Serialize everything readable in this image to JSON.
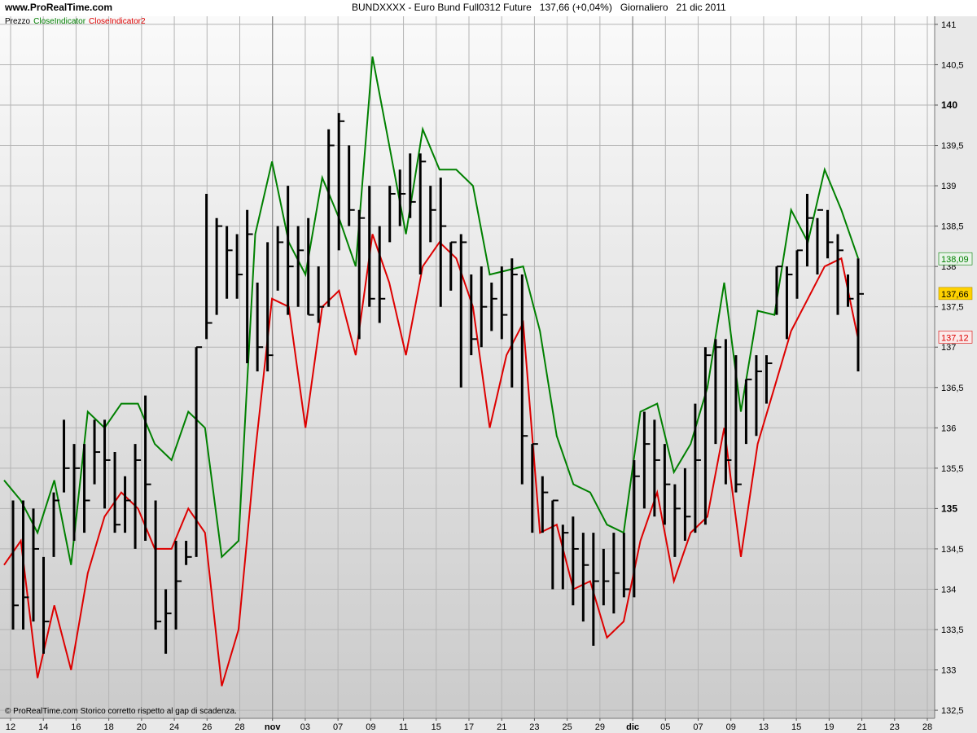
{
  "header": {
    "site": "www.ProRealTime.com",
    "instrument": "BUNDXXXX - Euro Bund Full0312 Future",
    "last_change": "137,66 (+0,04%)",
    "period": "Giornaliero",
    "date": "21 dic 2011"
  },
  "legend": [
    {
      "label": "Prezzo",
      "color": "#000000"
    },
    {
      "label": "CloseIndicator",
      "color": "#008000"
    },
    {
      "label": "CloseIndicator2",
      "color": "#dd0000"
    }
  ],
  "footer": {
    "copyright": "© ProRealTime.com  Storico corretto rispetto al gap di scadenza."
  },
  "chart_data": {
    "type": "line",
    "ylim": [
      132.4,
      141.1
    ],
    "grid": true,
    "y_ticks": [
      "141",
      "140,5",
      "140",
      "139,5",
      "139",
      "138,5",
      "138",
      "137,5",
      "137",
      "136,5",
      "136",
      "135,5",
      "135",
      "134,5",
      "134",
      "133,5",
      "133",
      "132,5"
    ],
    "y_tick_values": [
      141,
      140.5,
      140,
      139.5,
      139,
      138.5,
      138,
      137.5,
      137,
      136.5,
      136,
      135.5,
      135,
      134.5,
      134,
      133.5,
      133,
      132.5
    ],
    "bold_ticks": [
      140,
      135
    ],
    "x_ticks": [
      "12",
      "14",
      "16",
      "18",
      "20",
      "24",
      "26",
      "28",
      "nov",
      "03",
      "07",
      "09",
      "11",
      "15",
      "17",
      "21",
      "23",
      "25",
      "29",
      "dic",
      "05",
      "07",
      "09",
      "13",
      "15",
      "19",
      "21",
      "23",
      "28"
    ],
    "bold_x_ticks": [
      "nov",
      "dic"
    ],
    "price_bars": [
      {
        "high": 135.1,
        "low": 133.5,
        "close": 133.8
      },
      {
        "high": 135.1,
        "low": 133.5,
        "close": 133.9
      },
      {
        "high": 135.0,
        "low": 133.6,
        "close": 134.5
      },
      {
        "high": 134.4,
        "low": 133.2,
        "close": 133.6
      },
      {
        "high": 135.2,
        "low": 134.4,
        "close": 135.1
      },
      {
        "high": 136.1,
        "low": 135.2,
        "close": 135.5
      },
      {
        "high": 135.8,
        "low": 134.6,
        "close": 135.5
      },
      {
        "high": 135.8,
        "low": 134.7,
        "close": 135.1
      },
      {
        "high": 136.1,
        "low": 135.3,
        "close": 135.7
      },
      {
        "high": 136.1,
        "low": 135.0,
        "close": 135.6
      },
      {
        "high": 135.7,
        "low": 134.7,
        "close": 134.8
      },
      {
        "high": 135.4,
        "low": 134.7,
        "close": 135.1
      },
      {
        "high": 135.8,
        "low": 134.5,
        "close": 135.6
      },
      {
        "high": 136.4,
        "low": 134.6,
        "close": 135.3
      },
      {
        "high": 135.1,
        "low": 133.5,
        "close": 133.6
      },
      {
        "high": 134.0,
        "low": 133.2,
        "close": 133.7
      },
      {
        "high": 134.6,
        "low": 133.5,
        "close": 134.1
      },
      {
        "high": 134.6,
        "low": 134.3,
        "close": 134.4
      },
      {
        "high": 137.0,
        "low": 134.4,
        "close": 137.0
      },
      {
        "high": 138.9,
        "low": 137.1,
        "close": 137.3
      },
      {
        "high": 138.6,
        "low": 137.4,
        "close": 138.5
      },
      {
        "high": 138.5,
        "low": 137.6,
        "close": 138.2
      },
      {
        "high": 138.4,
        "low": 137.6,
        "close": 137.9
      },
      {
        "high": 138.7,
        "low": 136.8,
        "close": 138.4
      },
      {
        "high": 137.8,
        "low": 136.7,
        "close": 137.0
      },
      {
        "high": 138.3,
        "low": 136.7,
        "close": 136.9
      },
      {
        "high": 138.5,
        "low": 137.7,
        "close": 138.3
      },
      {
        "high": 139.0,
        "low": 137.4,
        "close": 138.0
      },
      {
        "high": 138.5,
        "low": 137.5,
        "close": 138.2
      },
      {
        "high": 138.6,
        "low": 137.4,
        "close": 137.4
      },
      {
        "high": 138.0,
        "low": 137.3,
        "close": 137.5
      },
      {
        "high": 139.7,
        "low": 137.5,
        "close": 139.5
      },
      {
        "high": 139.9,
        "low": 138.2,
        "close": 139.8
      },
      {
        "high": 139.5,
        "low": 138.5,
        "close": 138.7
      },
      {
        "high": 138.7,
        "low": 137.1,
        "close": 138.6
      },
      {
        "high": 139.0,
        "low": 137.5,
        "close": 137.6
      },
      {
        "high": 138.5,
        "low": 137.3,
        "close": 137.6
      },
      {
        "high": 139.0,
        "low": 138.3,
        "close": 138.9
      },
      {
        "high": 139.2,
        "low": 138.5,
        "close": 138.9
      },
      {
        "high": 139.4,
        "low": 138.6,
        "close": 138.8
      },
      {
        "high": 139.4,
        "low": 137.9,
        "close": 139.3
      },
      {
        "high": 139.0,
        "low": 138.3,
        "close": 138.7
      },
      {
        "high": 139.1,
        "low": 137.5,
        "close": 138.5
      },
      {
        "high": 138.3,
        "low": 137.7,
        "close": 138.3
      },
      {
        "high": 138.4,
        "low": 136.5,
        "close": 138.3
      },
      {
        "high": 137.9,
        "low": 136.9,
        "close": 137.1
      },
      {
        "high": 138.0,
        "low": 137.0,
        "close": 137.5
      },
      {
        "high": 137.8,
        "low": 137.2,
        "close": 137.6
      },
      {
        "high": 138.0,
        "low": 137.1,
        "close": 137.4
      },
      {
        "high": 138.1,
        "low": 136.5,
        "close": 137.9
      },
      {
        "high": 137.9,
        "low": 135.3,
        "close": 135.9
      },
      {
        "high": 135.8,
        "low": 134.7,
        "close": 135.8
      },
      {
        "high": 135.4,
        "low": 134.7,
        "close": 135.2
      },
      {
        "high": 135.1,
        "low": 134.0,
        "close": 135.1
      },
      {
        "high": 134.8,
        "low": 134.0,
        "close": 134.7
      },
      {
        "high": 134.9,
        "low": 133.8,
        "close": 134.5
      },
      {
        "high": 134.7,
        "low": 133.6,
        "close": 134.3
      },
      {
        "high": 134.7,
        "low": 133.3,
        "close": 134.1
      },
      {
        "high": 134.5,
        "low": 133.8,
        "close": 134.1
      },
      {
        "high": 134.7,
        "low": 133.7,
        "close": 134.2
      },
      {
        "high": 134.7,
        "low": 133.9,
        "close": 134.0
      },
      {
        "high": 135.6,
        "low": 133.9,
        "close": 135.4
      },
      {
        "high": 136.2,
        "low": 135.0,
        "close": 135.8
      },
      {
        "high": 136.1,
        "low": 134.9,
        "close": 135.6
      },
      {
        "high": 135.8,
        "low": 134.8,
        "close": 135.3
      },
      {
        "high": 135.3,
        "low": 134.4,
        "close": 135.0
      },
      {
        "high": 135.5,
        "low": 134.6,
        "close": 134.9
      },
      {
        "high": 136.3,
        "low": 134.7,
        "close": 135.6
      },
      {
        "high": 137.0,
        "low": 134.8,
        "close": 136.9
      },
      {
        "high": 137.1,
        "low": 135.8,
        "close": 137.0
      },
      {
        "high": 137.1,
        "low": 135.3,
        "close": 135.6
      },
      {
        "high": 136.9,
        "low": 135.2,
        "close": 135.3
      },
      {
        "high": 136.6,
        "low": 135.8,
        "close": 136.6
      },
      {
        "high": 136.9,
        "low": 135.9,
        "close": 136.7
      },
      {
        "high": 136.9,
        "low": 136.3,
        "close": 136.8
      },
      {
        "high": 138.0,
        "low": 137.4,
        "close": 138.0
      },
      {
        "high": 138.0,
        "low": 137.1,
        "close": 137.9
      },
      {
        "high": 138.2,
        "low": 137.6,
        "close": 138.2
      },
      {
        "high": 138.9,
        "low": 138.0,
        "close": 138.6
      },
      {
        "high": 138.6,
        "low": 137.9,
        "close": 138.7
      },
      {
        "high": 138.7,
        "low": 138.1,
        "close": 138.3
      },
      {
        "high": 138.4,
        "low": 137.4,
        "close": 138.2
      },
      {
        "high": 137.9,
        "low": 137.5,
        "close": 137.6
      },
      {
        "high": 138.1,
        "low": 136.7,
        "close": 137.66
      }
    ],
    "series": [
      {
        "name": "CloseIndicator",
        "color": "#008000",
        "values": [
          135.35,
          135.1,
          134.7,
          135.35,
          134.3,
          136.2,
          136.0,
          136.3,
          136.3,
          135.8,
          135.6,
          136.2,
          136.0,
          134.4,
          134.6,
          138.4,
          139.3,
          138.3,
          137.9,
          139.1,
          138.6,
          138.0,
          140.6,
          139.5,
          138.4,
          139.7,
          139.2,
          139.2,
          139.0,
          137.9,
          137.95,
          138.0,
          137.2,
          135.9,
          135.3,
          135.2,
          134.8,
          134.7,
          136.2,
          136.3,
          135.45,
          135.8,
          136.5,
          137.8,
          136.2,
          137.45,
          137.4,
          138.7,
          138.3,
          139.2,
          138.7,
          138.1
        ]
      },
      {
        "name": "CloseIndicator2",
        "color": "#dd0000",
        "values": [
          134.3,
          134.6,
          132.9,
          133.8,
          133.0,
          134.2,
          134.9,
          135.2,
          135.0,
          134.5,
          134.5,
          135.0,
          134.7,
          132.8,
          133.5,
          135.7,
          137.6,
          137.5,
          136.0,
          137.5,
          137.7,
          136.9,
          138.4,
          137.8,
          136.9,
          138.0,
          138.3,
          138.1,
          137.5,
          136.0,
          136.9,
          137.3,
          134.7,
          134.8,
          134.0,
          134.1,
          133.4,
          133.6,
          134.6,
          135.2,
          134.1,
          134.7,
          134.9,
          136.0,
          134.4,
          135.8,
          136.5,
          137.2,
          137.6,
          138.0,
          138.1,
          137.1
        ]
      }
    ],
    "last_value_labels": [
      {
        "label": "138,09",
        "value": 138.09,
        "color": "#008000",
        "bg": "#e9f4e9"
      },
      {
        "label": "137,66",
        "value": 137.66,
        "color": "#000000",
        "bg": "#ffd200"
      },
      {
        "label": "137,12",
        "value": 137.12,
        "color": "#dd0000",
        "bg": "#fbeaea"
      }
    ]
  }
}
